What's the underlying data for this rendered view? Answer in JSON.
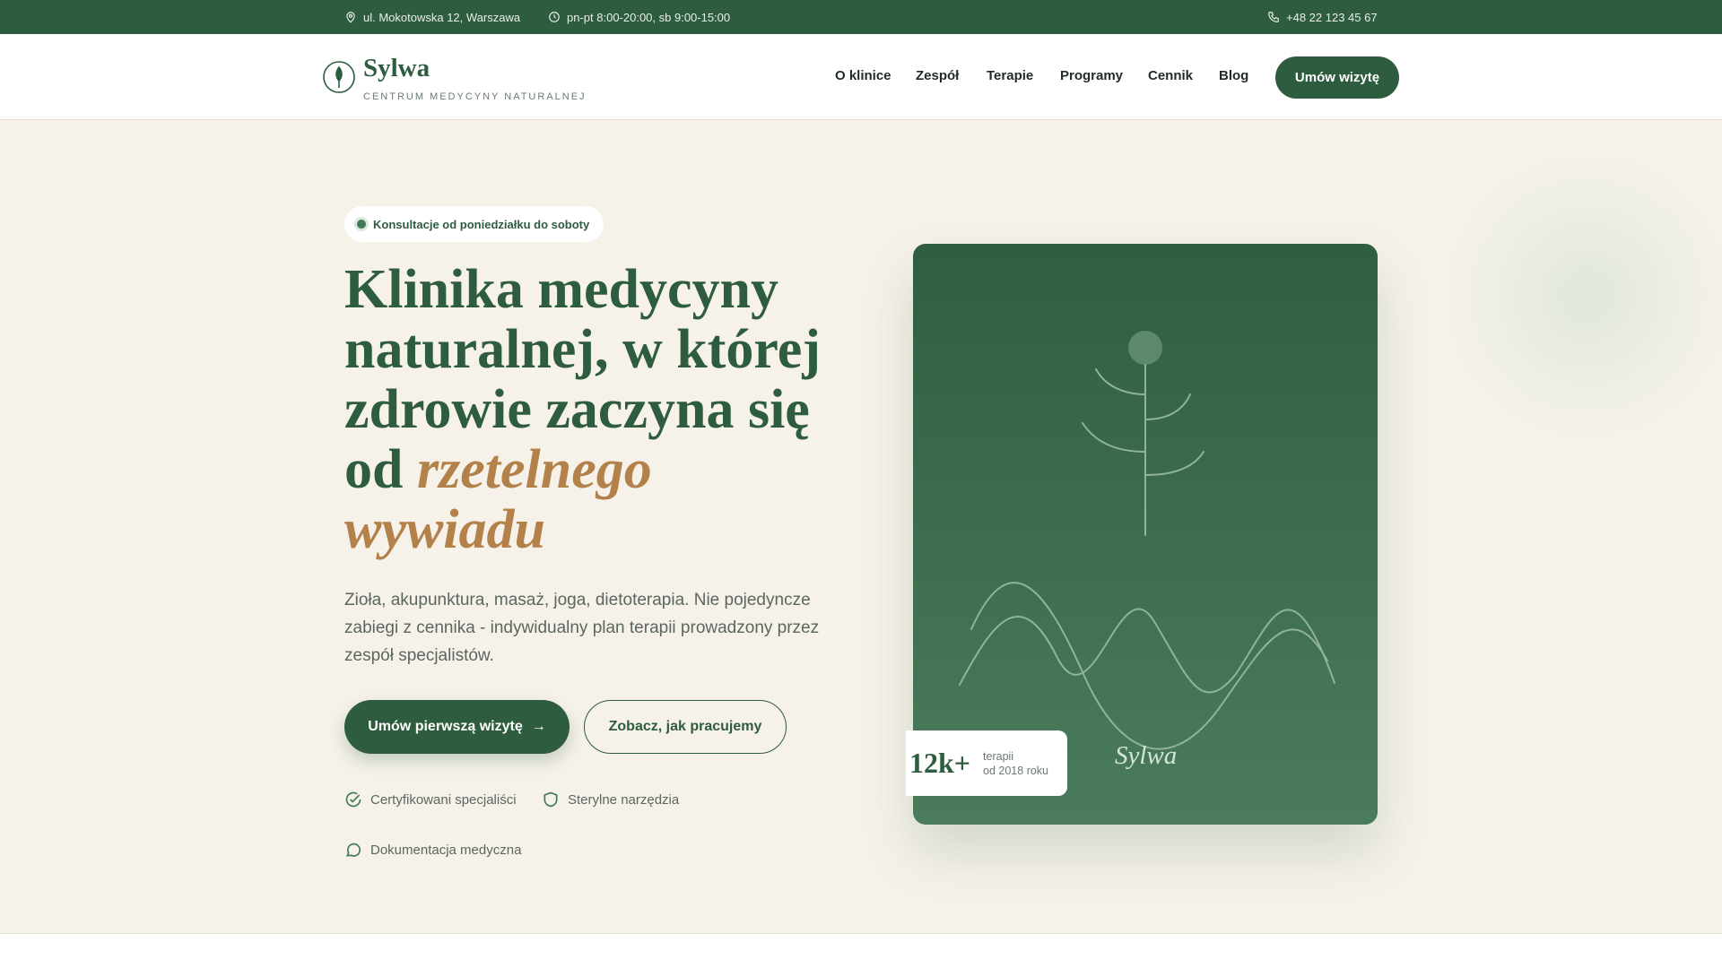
{
  "topbar": {
    "address": "ul. Mokotowska 12, Warszawa",
    "hours": "pn-pt 8:00-20:00, sb 9:00-15:00",
    "phone": "+48 22 123 45 67"
  },
  "brand": {
    "name": "Sylwa",
    "tagline": "CENTRUM MEDYCYNY NATURALNEJ"
  },
  "nav": {
    "items": [
      "O klinice",
      "Zespół",
      "Terapie",
      "Programy",
      "Cennik",
      "Blog"
    ],
    "cta": "Umów wizytę"
  },
  "hero": {
    "badge": "Konsultacje od poniedziałku do soboty",
    "headline_lines": [
      "Klinika medycyny",
      "naturalnej, w której",
      "zdrowie zaczyna się"
    ],
    "headline_prefix": "od ",
    "headline_accent_1": "rzetelnego",
    "headline_accent_2": "wywiadu",
    "lead": "Zioła, akupunktura, masaż, joga, dietoterapia. Nie pojedyncze zabiegi z cennika - indywidualny plan terapii prowadzony przez zespół specjalistów.",
    "primary_cta": "Umów pierwszą wizytę",
    "primary_cta_icon": "→",
    "secondary_cta": "Zobacz, jak pracujemy",
    "features": [
      "Certyfikowani specjaliści",
      "Sterylne narzędzia",
      "Dokumentacja medyczna"
    ]
  },
  "card": {
    "signature": "Sylwa",
    "stat_value": "12k+",
    "stat_label_1": "terapii",
    "stat_label_2": "od 2018 roku"
  },
  "colors": {
    "brand_green": "#2e5c3e",
    "accent_gold": "#b3814a",
    "background": "#f6f2ea"
  },
  "icons": [
    "map-pin-icon",
    "clock-icon",
    "phone-icon",
    "leaf-logo-icon",
    "arrow-right-icon",
    "check-circle-icon",
    "shield-icon",
    "chat-icon"
  ]
}
